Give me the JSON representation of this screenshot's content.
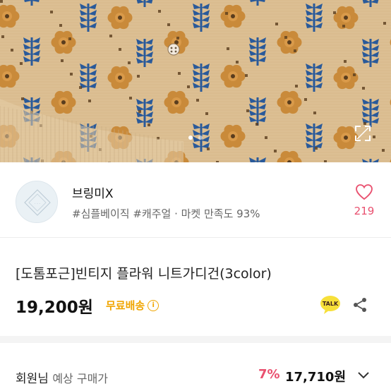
{
  "hero": {
    "pattern_colors": {
      "base": "#dcbf93",
      "flower": "#c98a3a",
      "leaf": "#2a5a9a",
      "dark": "#5a3d1e"
    },
    "slides": 2,
    "active_slide": 0,
    "expand_icon": "expand-icon"
  },
  "shop": {
    "name": "브링미X",
    "tags": "#심플베이직 #캐주얼 · 마켓 만족도 93%",
    "likes": "219",
    "like_icon": "heart-icon"
  },
  "product": {
    "title": "[도톰포근]빈티지 플라워 니트가디건(3color)",
    "price": "19,200원",
    "shipping": "무료배송",
    "shipping_info_icon": "i",
    "talk_label": "TALK"
  },
  "member_price": {
    "label": "회원님",
    "sub_label": "예상 구매가",
    "discount": "7%",
    "price": "17,710원"
  },
  "colors": {
    "accent_pink": "#e9506f",
    "accent_yellow": "#f0a500",
    "kakao": "#f7e03a"
  }
}
